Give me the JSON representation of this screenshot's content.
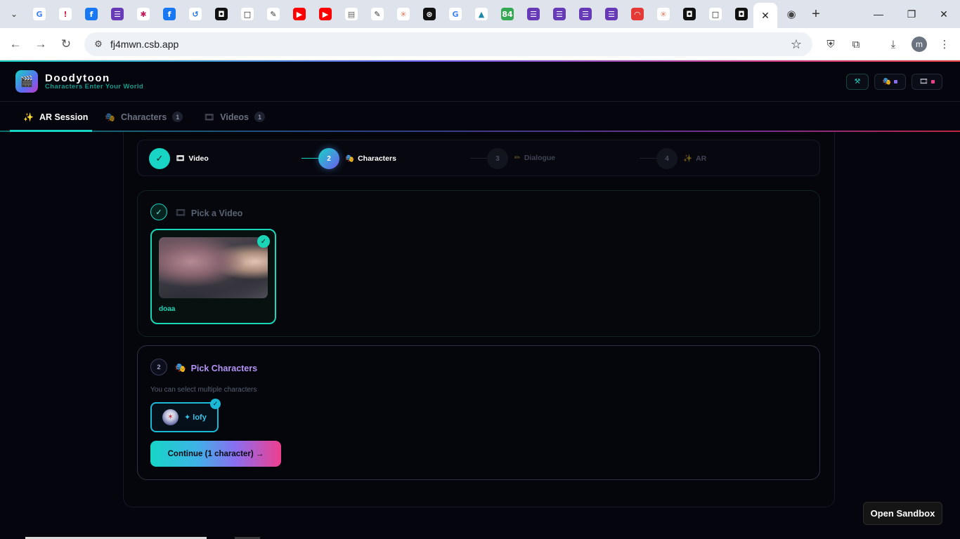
{
  "browser": {
    "url": "fj4mwn.csb.app",
    "favicons": [
      {
        "name": "google-favicon",
        "glyph": "G",
        "bg": "#ffffff",
        "fg": "#4285f4"
      },
      {
        "name": "alert-favicon",
        "glyph": "!",
        "bg": "#ffffff",
        "fg": "#d3244a"
      },
      {
        "name": "facebook-favicon",
        "glyph": "f",
        "bg": "#1877f2",
        "fg": "#ffffff"
      },
      {
        "name": "forms-favicon",
        "glyph": "☰",
        "bg": "#673ab7",
        "fg": "#ffffff"
      },
      {
        "name": "bug-favicon",
        "glyph": "✱",
        "bg": "#ffffff",
        "fg": "#c2185b"
      },
      {
        "name": "facebook-favicon-2",
        "glyph": "f",
        "bg": "#1877f2",
        "fg": "#ffffff"
      },
      {
        "name": "history-favicon",
        "glyph": "↺",
        "bg": "#ffffff",
        "fg": "#1a73e8"
      },
      {
        "name": "square-favicon",
        "glyph": "◘",
        "bg": "#111111",
        "fg": "#ffffff"
      },
      {
        "name": "square-outline-favicon",
        "glyph": "□",
        "bg": "#ffffff",
        "fg": "#111111"
      },
      {
        "name": "puzzle-favicon",
        "glyph": "✎",
        "bg": "#ffffff",
        "fg": "#333333"
      },
      {
        "name": "youtube-favicon",
        "glyph": "▶",
        "bg": "#ff0000",
        "fg": "#ffffff"
      },
      {
        "name": "youtube-favicon-2",
        "glyph": "▶",
        "bg": "#ff0000",
        "fg": "#ffffff"
      },
      {
        "name": "monument-favicon",
        "glyph": "▤",
        "bg": "#ffffff",
        "fg": "#666666"
      },
      {
        "name": "puzzle-favicon-2",
        "glyph": "✎",
        "bg": "#ffffff",
        "fg": "#333333"
      },
      {
        "name": "claude-favicon",
        "glyph": "✳",
        "bg": "#ffffff",
        "fg": "#d97757"
      },
      {
        "name": "openai-favicon",
        "glyph": "⊛",
        "bg": "#111111",
        "fg": "#ffffff"
      },
      {
        "name": "google-favicon-2",
        "glyph": "G",
        "bg": "#ffffff",
        "fg": "#4285f4"
      },
      {
        "name": "graduation-favicon",
        "glyph": "▲",
        "bg": "#ffffff",
        "fg": "#1e88a8"
      },
      {
        "name": "badge-84-favicon",
        "glyph": "84",
        "bg": "#34a853",
        "fg": "#ffffff"
      },
      {
        "name": "forms-favicon-2",
        "glyph": "☰",
        "bg": "#673ab7",
        "fg": "#ffffff"
      },
      {
        "name": "forms-favicon-3",
        "glyph": "☰",
        "bg": "#673ab7",
        "fg": "#ffffff"
      },
      {
        "name": "forms-favicon-4",
        "glyph": "☰",
        "bg": "#673ab7",
        "fg": "#ffffff"
      },
      {
        "name": "forms-favicon-5",
        "glyph": "☰",
        "bg": "#673ab7",
        "fg": "#ffffff"
      },
      {
        "name": "podcast-favicon",
        "glyph": "◠",
        "bg": "#e53935",
        "fg": "#ffffff"
      },
      {
        "name": "claude-favicon-2",
        "glyph": "✳",
        "bg": "#ffffff",
        "fg": "#d97757"
      },
      {
        "name": "square-favicon-2",
        "glyph": "◘",
        "bg": "#111111",
        "fg": "#ffffff"
      },
      {
        "name": "square-outline-favicon-2",
        "glyph": "□",
        "bg": "#ffffff",
        "fg": "#111111"
      },
      {
        "name": "square-favicon-3",
        "glyph": "◘",
        "bg": "#111111",
        "fg": "#ffffff"
      }
    ],
    "active_tab_close": "✕",
    "after_tab_favicon": {
      "glyph": "◉",
      "fg": "#444444"
    },
    "new_tab": "+",
    "profile_initial": "m"
  },
  "app": {
    "brand": {
      "name": "Doodytoon",
      "tagline": "Characters Enter Your World",
      "logo_glyph": "🎬"
    },
    "header_buttons": [
      {
        "name": "header-wrench-button",
        "glyph": "⚒",
        "accent": "#17d4c4"
      },
      {
        "name": "header-characters-button",
        "glyph": "🎭",
        "accent": "#8a6ef0"
      },
      {
        "name": "header-videos-button",
        "glyph": "🎞",
        "accent": "#ef3f8e"
      }
    ],
    "tabs": [
      {
        "label": "AR Session",
        "icon": "✨",
        "badge": ""
      },
      {
        "label": "Characters",
        "icon": "🎭",
        "badge": "1"
      },
      {
        "label": "Videos",
        "icon": "🎞",
        "badge": "1"
      }
    ],
    "stepper": [
      {
        "num": "✓",
        "label": "Video",
        "icon": "🎞",
        "state": "done"
      },
      {
        "num": "2",
        "label": "Characters",
        "icon": "🎭",
        "state": "active"
      },
      {
        "num": "3",
        "label": "Dialogue",
        "icon": "✏",
        "state": "pending"
      },
      {
        "num": "4",
        "label": "AR",
        "icon": "✨",
        "state": "pending"
      }
    ],
    "section_video": {
      "num": "✓",
      "icon": "🎞",
      "title": "Pick a Video",
      "selected_check": "✓",
      "video_name": "doaa"
    },
    "section_characters": {
      "num": "2",
      "icon": "🎭",
      "title": "Pick Characters",
      "hint": "You can select multiple characters",
      "character_name": "✦ lofy",
      "selected_check": "✓",
      "continue_label": "Continue (1 character) →"
    },
    "sandbox_label": "Open Sandbox",
    "colors": {
      "teal": "#17d4c4",
      "cyan": "#1ab9d6",
      "purple": "#8a6ef0",
      "pink": "#ef3f8e",
      "title_purple": "#b393f5"
    }
  }
}
